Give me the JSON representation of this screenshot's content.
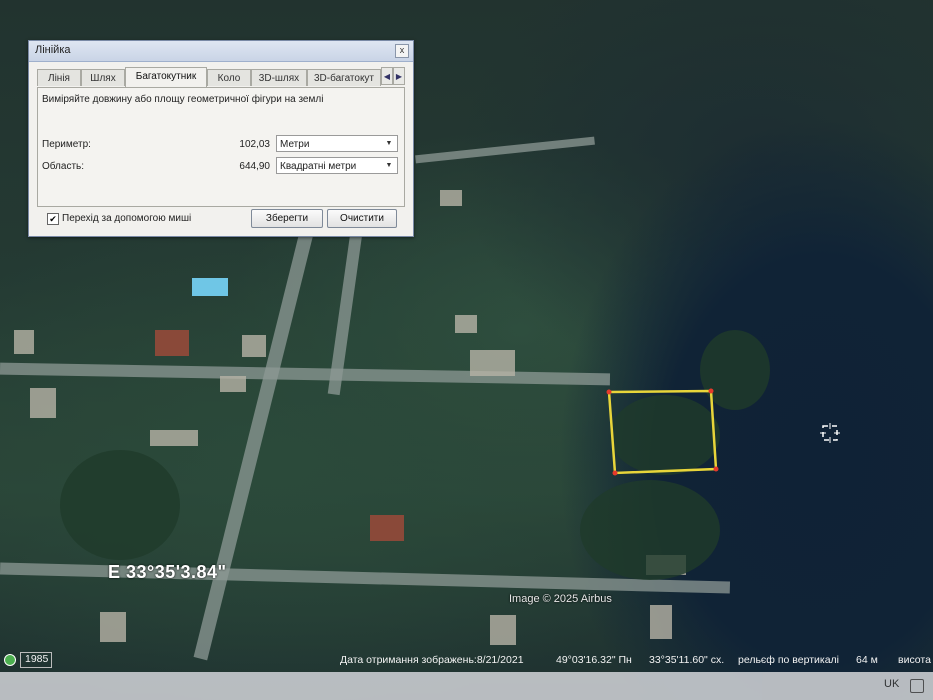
{
  "ruler": {
    "title": "Лінійка",
    "close": "x",
    "tabs": [
      "Лінія",
      "Шлях",
      "Багатокутник",
      "Коло",
      "3D-шлях",
      "3D-багатокут"
    ],
    "active_tab": "Багатокутник",
    "scroll_left": "◀",
    "scroll_right": "▶",
    "instruction": "Виміряйте довжину або площу геометричної фігури на землі",
    "perimeter_label": "Периметр:",
    "perimeter_value": "102,03",
    "perimeter_unit": "Метри",
    "area_label": "Область:",
    "area_value": "644,90",
    "area_unit": "Квадратні метри",
    "mouse_nav_checked": true,
    "mouse_nav_label": "Перехід за допомогою миші",
    "save_label": "Зберегти",
    "clear_label": "Очистити"
  },
  "map": {
    "longitude_label": "E 33°35'3.84\"",
    "copyright": "Image © 2025 Airbus",
    "polygon_color": "#e8d53a",
    "vertex_color": "#e53a2b",
    "water_color": "#102336"
  },
  "status_bar": {
    "year": "1985",
    "capture_date": "Дата отримання зображень:8/21/2021",
    "latitude": "49°03'16.32\" Пн",
    "longitude": "33°35'11.60\" сх.",
    "elevation_label": "рельєф по вертикалі",
    "elevation_value": "64 м",
    "altitude_label": "висота"
  },
  "taskbar": {
    "language": "UK"
  }
}
